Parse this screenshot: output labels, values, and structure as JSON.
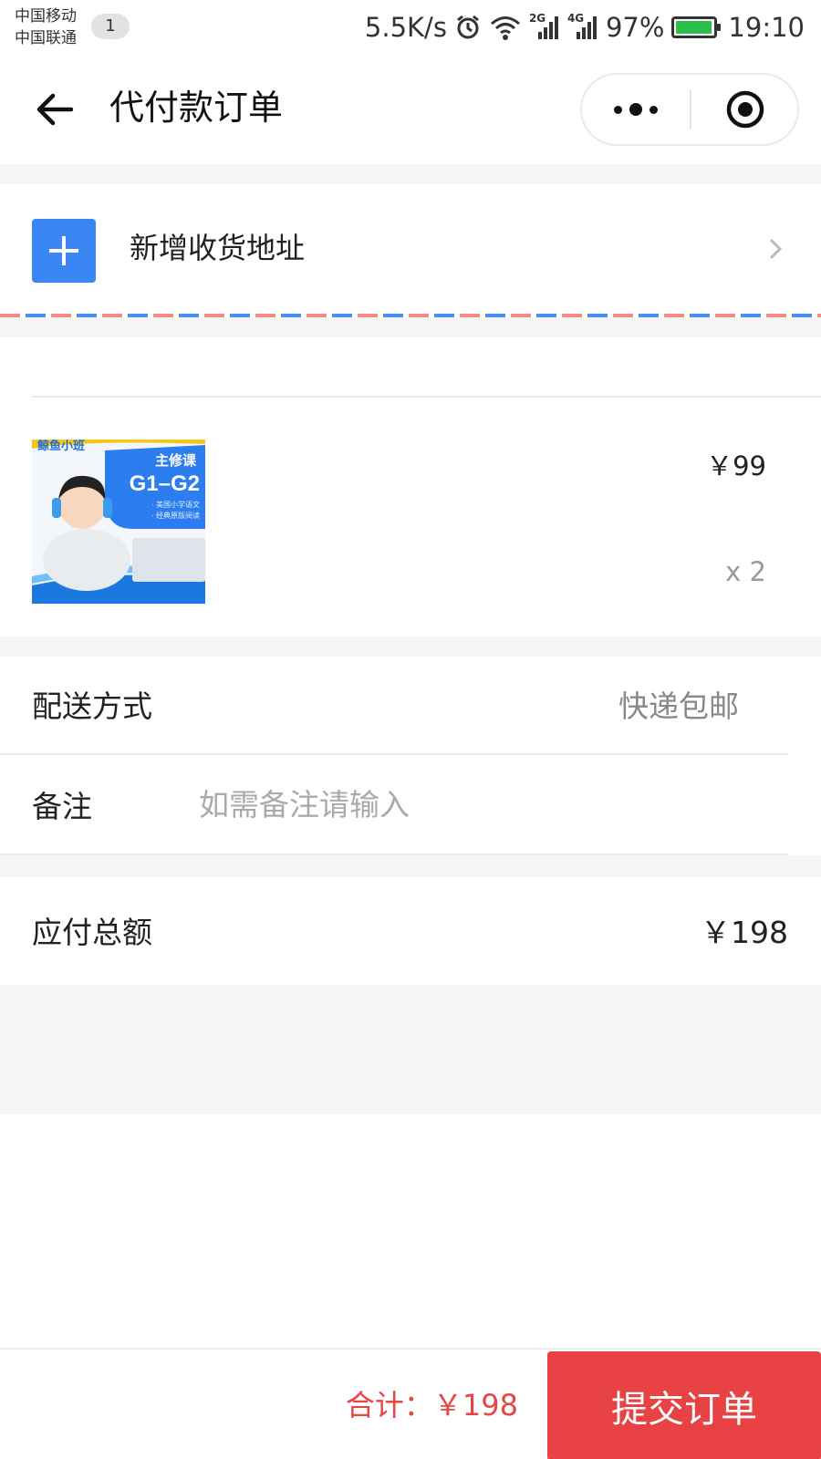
{
  "status_bar": {
    "carrier_1": "中国移动",
    "carrier_2": "中国联通",
    "notification_count": "1",
    "network_speed": "5.5K/s",
    "signal_1_label": "2G",
    "signal_2_label": "4G",
    "battery_percent": "97%",
    "battery_level": 0.97,
    "time": "19:10",
    "icons": [
      "alarm-icon",
      "wifi-icon",
      "signal-icon",
      "signal-icon",
      "battery-icon"
    ]
  },
  "nav": {
    "title": "代付款订单",
    "back_icon": "arrow-left-icon",
    "more_icon": "more-dots-icon",
    "close_icon": "target-circle-icon"
  },
  "address": {
    "label": "新增收货地址",
    "icon": "plus-icon",
    "chevron_icon": "chevron-right-icon"
  },
  "product": {
    "price": "￥99",
    "quantity": "x 2",
    "image": {
      "logo": "鲸鱼小班",
      "headline": "主修课",
      "course": "G1–G2",
      "line_1": "· 美国小学语文",
      "line_2": "· 经典原版阅读"
    }
  },
  "delivery": {
    "label": "配送方式",
    "value": "快递包邮"
  },
  "remark": {
    "label": "备注",
    "placeholder": "如需备注请输入",
    "value": ""
  },
  "total_due": {
    "label": "应付总额",
    "value": "￥198"
  },
  "footer": {
    "total_text": "合计：￥198",
    "submit_label": "提交订单"
  },
  "colors": {
    "accent_blue": "#3b86f5",
    "submit_red": "#e84245",
    "total_red": "#e84545",
    "background_gray": "#f5f5f5",
    "battery_green": "#2dbf4a"
  }
}
